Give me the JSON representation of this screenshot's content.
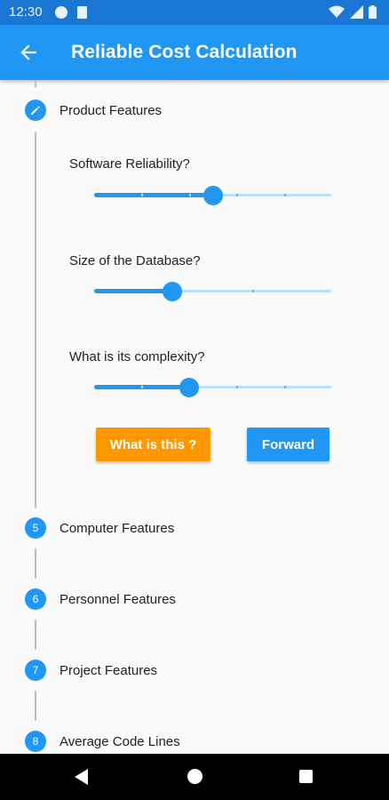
{
  "status_bar": {
    "time": "12:30",
    "icons": [
      "app-notification-icon",
      "sd-card-icon",
      "wifi-icon",
      "signal-icon",
      "battery-icon"
    ]
  },
  "app_bar": {
    "title": "Reliable Cost Calculation",
    "back_icon": "arrow-back-icon",
    "color": "#2196f3"
  },
  "active_step": {
    "title": "Product Features",
    "icon": "edit-pencil-icon",
    "questions": [
      {
        "label": "Software Reliability?",
        "value_fraction": 0.5,
        "divisions": 5
      },
      {
        "label": "Size of the Database?",
        "value_fraction": 0.33,
        "divisions": 3
      },
      {
        "label": "What is its complexity?",
        "value_fraction": 0.4,
        "divisions": 5
      }
    ],
    "buttons": {
      "help_label": "What is this ?",
      "forward_label": "Forward"
    }
  },
  "steps": [
    {
      "number": "5",
      "title": "Computer Features"
    },
    {
      "number": "6",
      "title": "Personnel Features"
    },
    {
      "number": "7",
      "title": "Project Features"
    },
    {
      "number": "8",
      "title": "Average Code Lines"
    }
  ],
  "colors": {
    "primary": "#2196f3",
    "primary_dark": "#1976d2",
    "accent_orange": "#ff9800",
    "slider_track": "#bbdefb"
  }
}
